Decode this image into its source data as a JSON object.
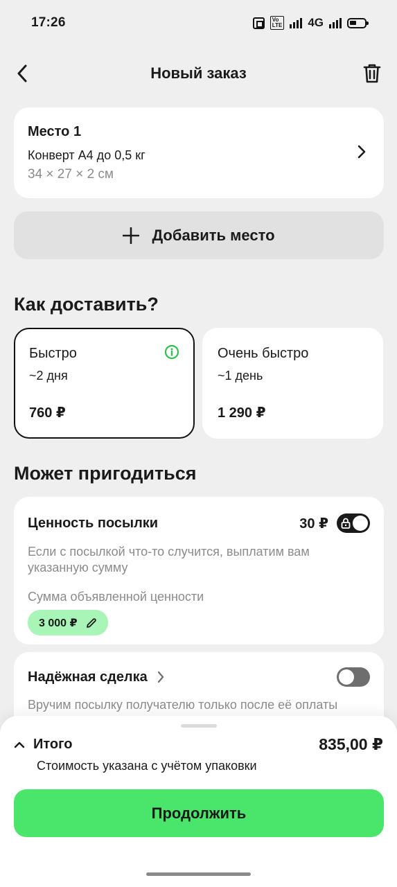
{
  "status_bar": {
    "time": "17:26",
    "network": "4G",
    "volte": "Vo LTE 2"
  },
  "header": {
    "title": "Новый заказ"
  },
  "place": {
    "title": "Место 1",
    "description": "Конверт А4 до 0,5 кг",
    "size": "34 × 27 × 2 см"
  },
  "add_place": {
    "label": "Добавить место"
  },
  "delivery": {
    "title": "Как доставить?",
    "options": [
      {
        "name": "Быстро",
        "days": "~2 дня",
        "price": "760 ₽",
        "selected": true
      },
      {
        "name": "Очень быстро",
        "days": "~1 день",
        "price": "1 290 ₽",
        "selected": false
      }
    ]
  },
  "extras": {
    "title": "Может пригодиться",
    "value": {
      "title": "Ценность посылки",
      "price": "30 ₽",
      "enabled": true,
      "description": "Если с посылкой что-то случится, выплатим вам указанную сумму",
      "sum_label": "Сумма объявленной ценности",
      "sum_value": "3 000 ₽"
    },
    "safe_deal": {
      "title": "Надёжная сделка",
      "enabled": false,
      "description": "Вручим посылку получателю только после её оплаты"
    }
  },
  "summary": {
    "label": "Итого",
    "amount": "835,00 ₽",
    "note": "Стоимость указана с учётом упаковки",
    "continue_label": "Продолжить"
  },
  "colors": {
    "accent_green": "#4ae66b",
    "chip_green": "#a9f5b8",
    "info_green": "#2fbf4f"
  }
}
